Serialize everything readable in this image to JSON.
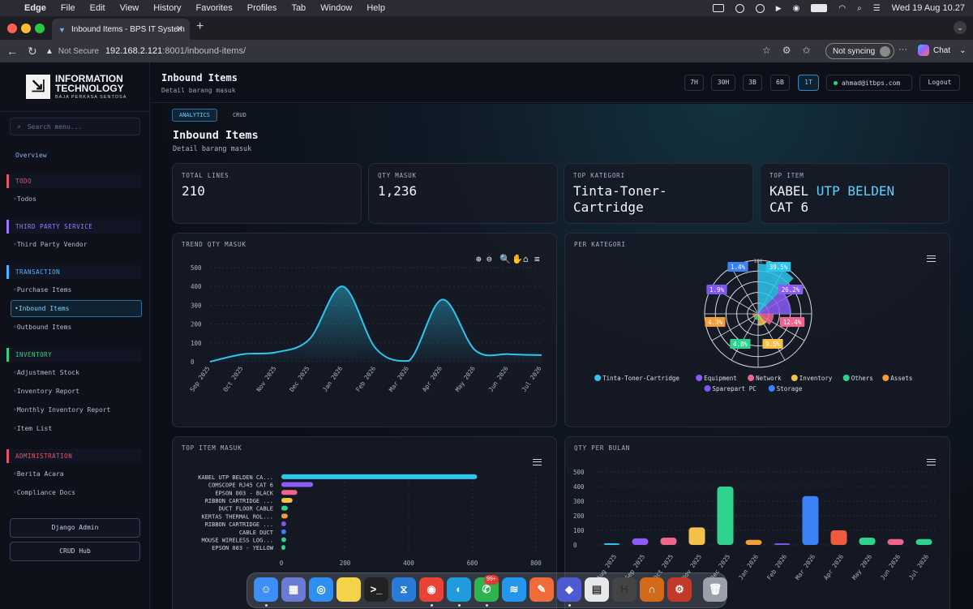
{
  "menubar": {
    "app": "Edge",
    "items": [
      "File",
      "Edit",
      "View",
      "History",
      "Favorites",
      "Profiles",
      "Tab",
      "Window",
      "Help"
    ],
    "clock": "Wed 19 Aug  10.27"
  },
  "browser": {
    "tab_title": "Inbound Items - BPS IT System",
    "security": "Not Secure",
    "url_host": "192.168.2.121",
    "url_path": ":8001/inbound-items/",
    "sync_label": "Not syncing",
    "chat_label": "Chat"
  },
  "sidebar": {
    "logo_line1": "INFORMATION",
    "logo_line2": "TECHNOLOGY",
    "logo_tagline": "BAJA PERKASA SENTOSA",
    "search_placeholder": "Search menu...",
    "overview": "Overview",
    "sections": [
      {
        "title": "TODO",
        "color": "#e0556b",
        "items": [
          "Todos"
        ]
      },
      {
        "title": "THIRD PARTY SERVICE",
        "color": "#9a7bff",
        "items": [
          "Third Party Vendor"
        ]
      },
      {
        "title": "TRANSACTION",
        "color": "#4bb6ff",
        "items": [
          "Purchase Items",
          "Inbound Items",
          "Outbound Items"
        ]
      },
      {
        "title": "INVENTORY",
        "color": "#2fd37e",
        "items": [
          "Adjustment Stock",
          "Inventory Report",
          "Monthly Inventory Report",
          "Item List"
        ]
      },
      {
        "title": "ADMINISTRATION",
        "color": "#e0556b",
        "items": [
          "Berita Acara",
          "Compliance Docs"
        ]
      }
    ],
    "active_item": "Inbound Items",
    "buttons": [
      "Django Admin",
      "CRUD Hub"
    ]
  },
  "header": {
    "title": "Inbound Items",
    "subtitle": "Detail barang masuk",
    "ranges": [
      "7H",
      "30H",
      "3B",
      "6B",
      "1T"
    ],
    "active_range": "1T",
    "user": "ahmad@itbps.com",
    "logout": "Logout"
  },
  "main": {
    "tabs": [
      "ANALYTICS",
      "CRUD"
    ],
    "active_tab": "ANALYTICS",
    "title": "Inbound Items",
    "subtitle": "Detail barang masuk",
    "kpis": [
      {
        "label": "TOTAL LINES",
        "value": "210"
      },
      {
        "label": "QTY MASUK",
        "value": "1,236"
      },
      {
        "label": "TOP KATEGORI",
        "value": "Tinta-Toner-\nCartridge"
      },
      {
        "label": "TOP ITEM",
        "value_parts": [
          "KABEL ",
          "UTP BELDEN",
          "\nCAT 6"
        ]
      }
    ]
  },
  "chart_data": [
    {
      "type": "area",
      "title": "TREND QTY MASUK",
      "x": [
        "Sep 2025",
        "Oct 2025",
        "Nov 2025",
        "Dec 2025",
        "Jan 2026",
        "Feb 2026",
        "Mar 2026",
        "Apr 2026",
        "May 2026",
        "Jun 2026",
        "Jul 2026"
      ],
      "series": [
        {
          "values": [
            0,
            40,
            50,
            120,
            400,
            70,
            5,
            330,
            60,
            40,
            35
          ]
        }
      ],
      "ylim": [
        0,
        500
      ],
      "yticks": [
        0,
        100,
        200,
        300,
        400,
        500
      ],
      "color": "#2ec5ef",
      "toolbar": [
        "zoom-in",
        "zoom-out",
        "zoom",
        "pan",
        "home",
        "menu"
      ]
    },
    {
      "type": "polar-bar",
      "title": "PER KATEGORI",
      "categories": [
        "Tinta-Toner-Cartridge",
        "Equipment",
        "Network",
        "Inventory",
        "Others",
        "Assets",
        "Sparepart PC",
        "Storage"
      ],
      "colors": [
        "#2ec5ef",
        "#8b5cf6",
        "#f0658e",
        "#f4c04a",
        "#2fd38e",
        "#f59e35",
        "#7e56f2",
        "#3b82f6"
      ],
      "percent_labels": [
        "39.5%",
        "26.2%",
        "12.4%",
        "9.5%",
        "4.8%",
        "4.3%",
        "1.9%",
        "1.4%"
      ],
      "label_colors": [
        "#2ec5ef",
        "#8b5cf6",
        "#f0658e",
        "#f4c04a",
        "#2fd38e",
        "#f59e35",
        "#7e56f2",
        "#3b82f6"
      ],
      "rlim": [
        0,
        100
      ]
    },
    {
      "type": "bar",
      "orientation": "horizontal",
      "title": "TOP ITEM MASUK",
      "categories": [
        "KABEL UTP BELDEN CA...",
        "COMSCOPE RJ45 CAT 6",
        "EPSON 003 - BLACK",
        "RIBBON CARTRIDGE ...",
        "DUCT FLOOR CABLE",
        "KERTAS THERMAL ROL...",
        "RIBBON CARTRIDGE ...",
        "CABLE DUCT",
        "MOUSE WIRELESS LOG...",
        "EPSON 003 - YELLOW"
      ],
      "values": [
        615,
        100,
        50,
        35,
        20,
        20,
        15,
        15,
        15,
        12
      ],
      "colors": [
        "#2ec5ef",
        "#8b5cf6",
        "#f0658e",
        "#f4c04a",
        "#2fd38e",
        "#f59e35",
        "#7e56f2",
        "#3b82f6",
        "#2fd38e",
        "#2fd38e"
      ],
      "xlim": [
        0,
        800
      ],
      "xticks": [
        0,
        200,
        400,
        600,
        800
      ]
    },
    {
      "type": "bar",
      "title": "QTY PER BULAN",
      "categories": [
        "Aug 2025",
        "Sep 2025",
        "Oct 2025",
        "Nov 2025",
        "Dec 2025",
        "Jan 2026",
        "Feb 2026",
        "Mar 2026",
        "Apr 2026",
        "May 2026",
        "Jun 2026",
        "Jul 2026"
      ],
      "tick_labels": [
        "Aug 2025",
        "Sep 2025",
        "Oct 2025",
        "Nov 2025",
        "Dec 2025",
        "Jan 2026",
        "Feb 2026",
        "Mar 2026",
        "Apr 2026",
        "May 2026",
        "Jun 2026",
        "Jul 2026"
      ],
      "values": [
        5,
        45,
        50,
        120,
        400,
        35,
        10,
        335,
        100,
        50,
        40,
        40
      ],
      "colors": [
        "#2ec5ef",
        "#8b5cf6",
        "#f0658e",
        "#f4c04a",
        "#2fd38e",
        "#f59e35",
        "#7e56f2",
        "#3b82f6",
        "#f05a3c",
        "#2fd38e",
        "#f0658e",
        "#2fd38e"
      ],
      "ylim": [
        0,
        500
      ],
      "yticks": [
        0,
        100,
        200,
        300,
        400,
        500
      ]
    }
  ],
  "dock": {
    "apps": [
      "finder",
      "launchpad",
      "safari",
      "notes",
      "terminal",
      "vscode",
      "chrome",
      "edge",
      "whatsapp",
      "docker",
      "pencil",
      "teams",
      "preview",
      "hub",
      "podcast",
      "security",
      "trash"
    ],
    "whatsapp_badge": "99+"
  }
}
